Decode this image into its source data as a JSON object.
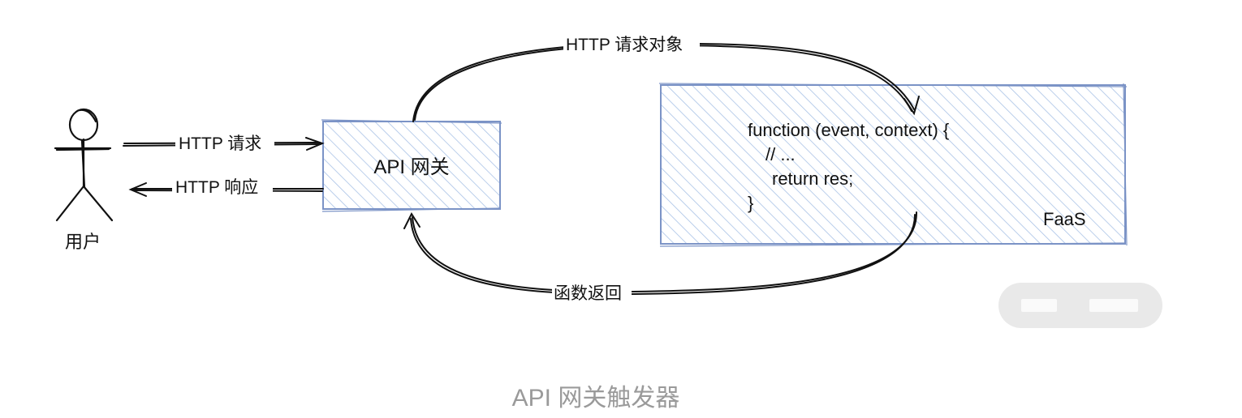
{
  "diagram": {
    "user": {
      "label": "用户"
    },
    "gateway": {
      "label": "API 网关"
    },
    "faas": {
      "label": "FaaS",
      "code_lines": [
        "function (event, context) {",
        "// ...",
        "return res;",
        "}"
      ]
    },
    "arrows": {
      "request": "HTTP 请求",
      "response": "HTTP 响应",
      "request_object": "HTTP 请求对象",
      "function_return": "函数返回"
    }
  },
  "caption": "API 网关触发器",
  "colors": {
    "box_stroke": "#7b93c6",
    "box_hatch": "#a9c2e6",
    "line": "#111111",
    "caption": "#9a9a9a"
  }
}
